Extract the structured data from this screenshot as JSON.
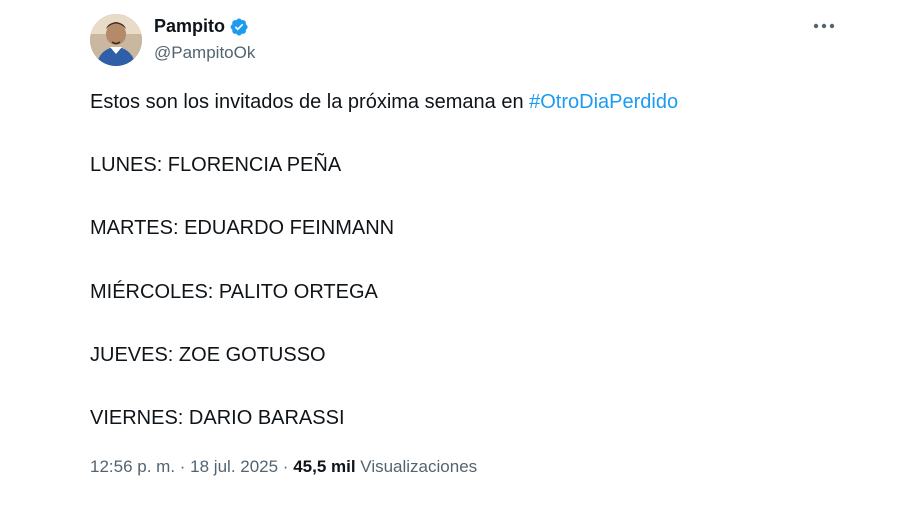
{
  "author": {
    "name": "Pampito",
    "handle": "@PampitoOk",
    "verified": true
  },
  "tweet": {
    "intro_text": "Estos son los invitados de la próxima semana en ",
    "hashtag": "#OtroDiaPerdido",
    "lines": [
      "LUNES: FLORENCIA PEÑA",
      "MARTES: EDUARDO FEINMANN",
      "MIÉRCOLES: PALITO ORTEGA",
      "JUEVES: ZOE GOTUSSO",
      "VIERNES: DARIO BARASSI"
    ]
  },
  "meta": {
    "time": "12:56 p. m.",
    "separator": " · ",
    "date": "18 jul. 2025",
    "views_count": "45,5 mil",
    "views_label": " Visualizaciones"
  },
  "icons": {
    "verified": "verified-badge-icon",
    "more": "more-options-icon"
  },
  "colors": {
    "accent": "#1d9bf0",
    "text": "#0f1419",
    "secondary": "#536471"
  }
}
